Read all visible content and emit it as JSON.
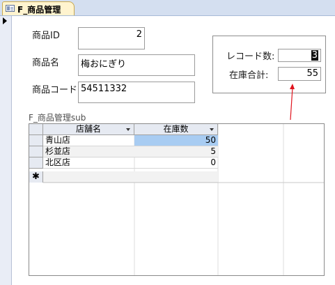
{
  "tab": {
    "title": "F_商品管理",
    "icon": "form-icon"
  },
  "form": {
    "product_id": {
      "label": "商品ID",
      "value": "2"
    },
    "product_name": {
      "label": "商品名",
      "value": "梅おにぎり"
    },
    "product_code": {
      "label": "商品コード",
      "value": "54511332"
    }
  },
  "summary": {
    "record_count": {
      "label": "レコード数:",
      "value": "3"
    },
    "stock_total": {
      "label": "在庫合計:",
      "value": "55"
    }
  },
  "annotation": {
    "color": "#e0141e"
  },
  "subform": {
    "label": "F_商品管理sub",
    "columns": [
      "店舗名",
      "在庫数"
    ],
    "rows": [
      {
        "store": "青山店",
        "stock": "50"
      },
      {
        "store": "杉並店",
        "stock": "5"
      },
      {
        "store": "北区店",
        "stock": "0"
      }
    ],
    "new_row_marker": "✱"
  }
}
